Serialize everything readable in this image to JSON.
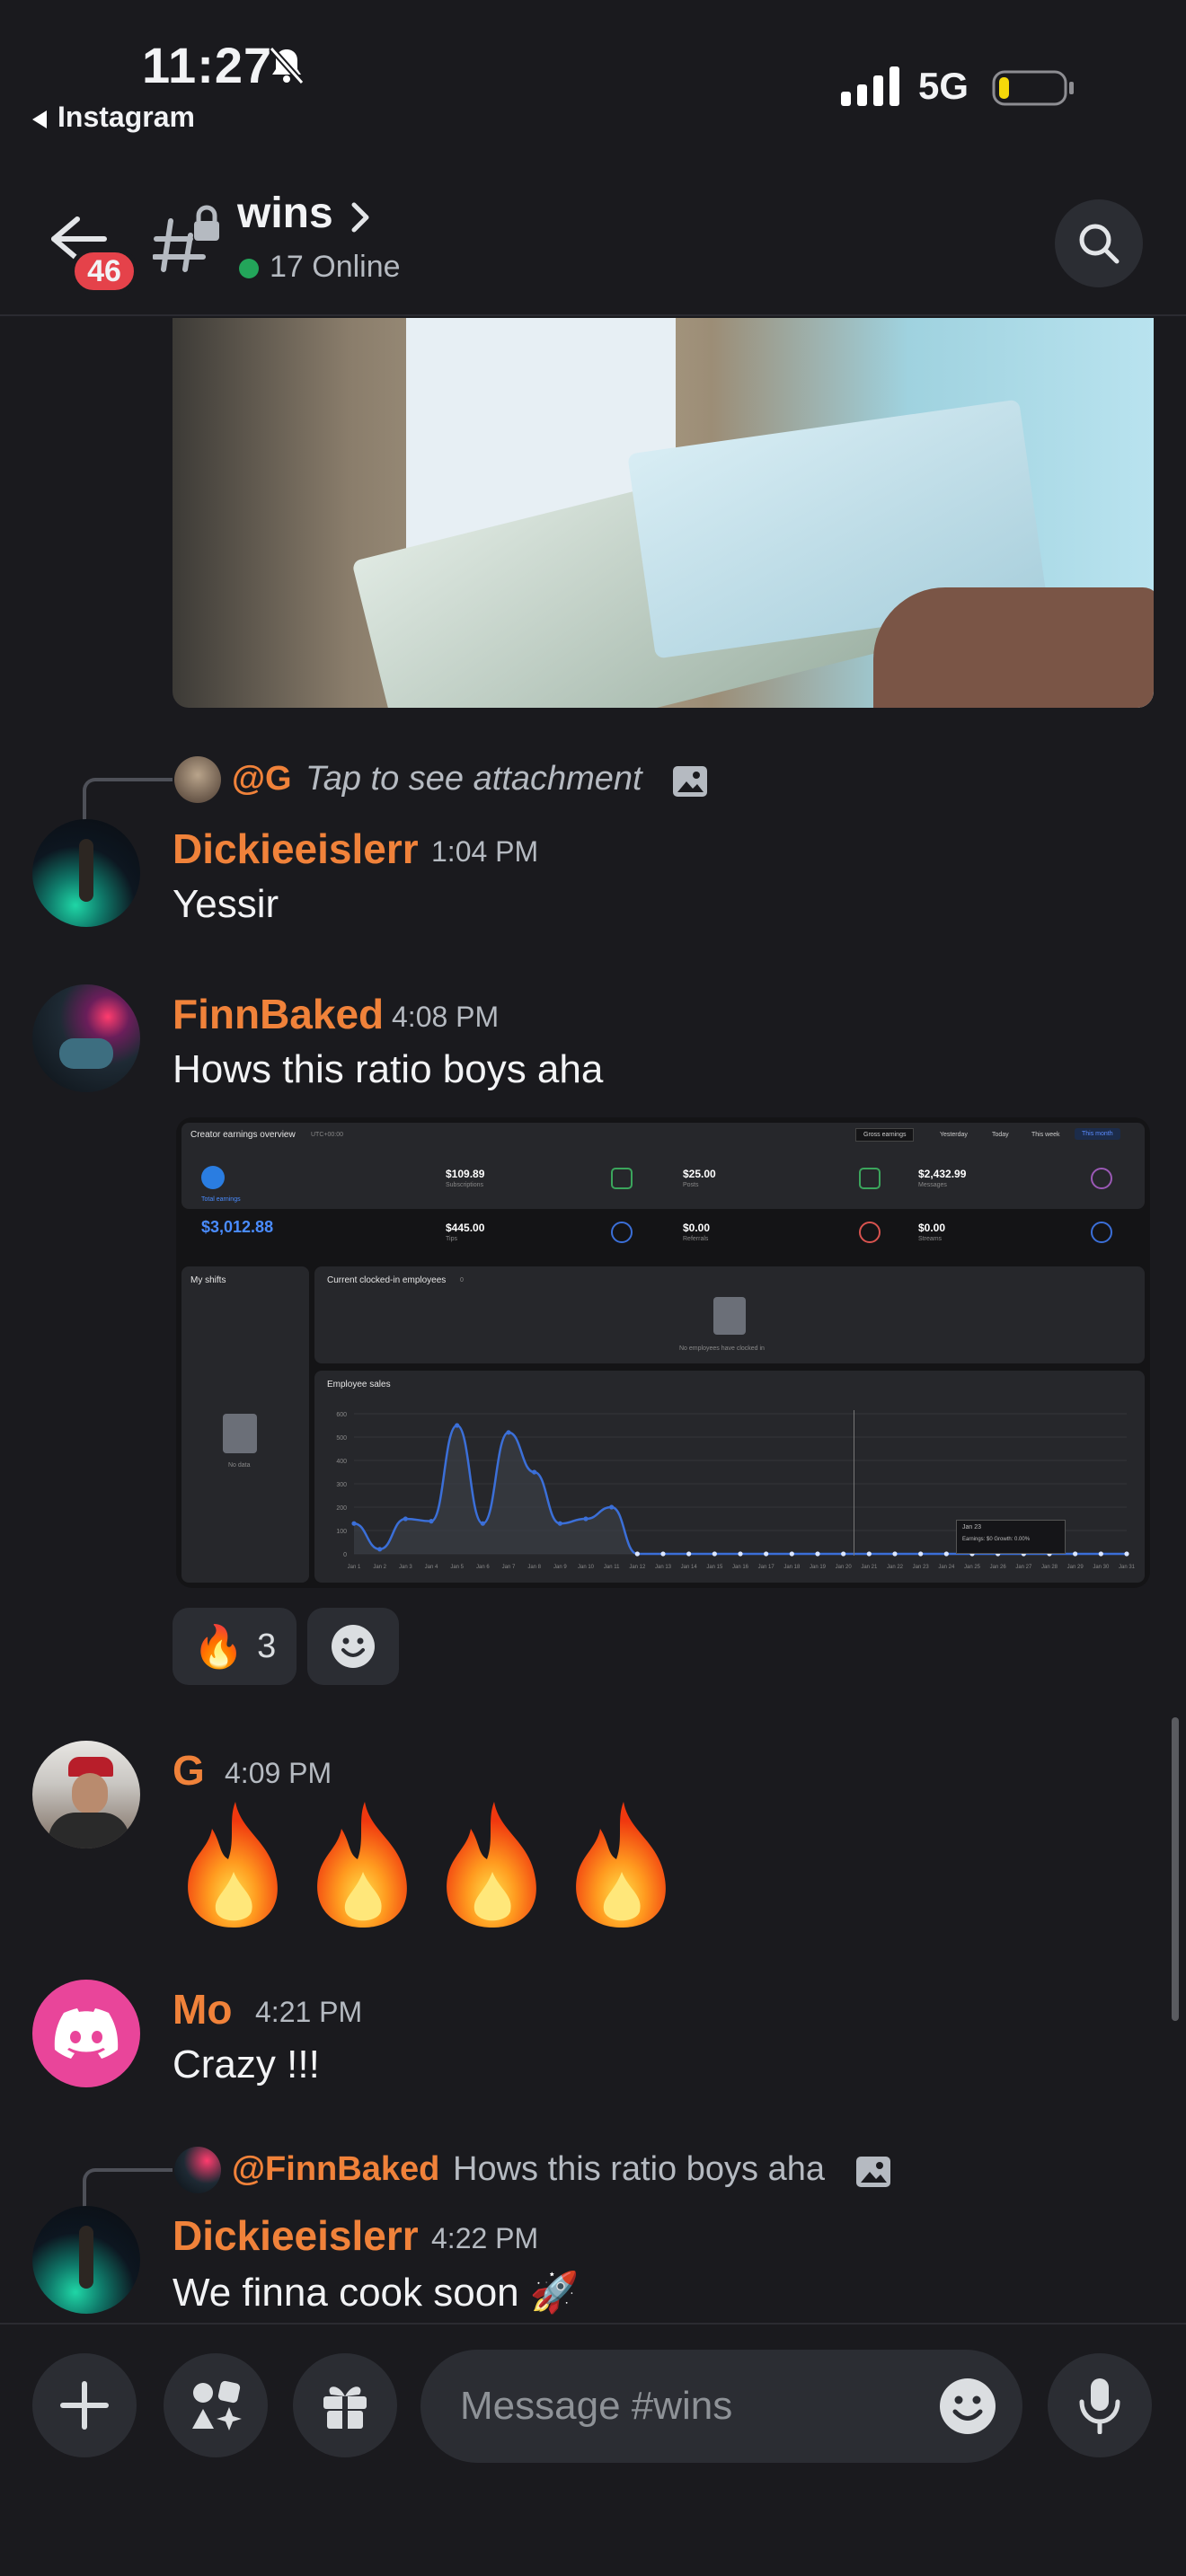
{
  "status_bar": {
    "time": "11:27",
    "back_app": "Instagram",
    "network": "5G"
  },
  "header": {
    "badge_count": "46",
    "channel_name": "wins",
    "online": "17 Online"
  },
  "messages": [
    {
      "reply": {
        "name": "@G",
        "text": "Tap to see attachment"
      },
      "author": "Dickieeislerr",
      "time": "1:04 PM",
      "text": "Yessir"
    },
    {
      "author": "FinnBaked",
      "time": "4:08 PM",
      "text": "Hows this ratio boys aha"
    },
    {
      "author": "G",
      "time": "4:09 PM",
      "text": "🔥🔥🔥🔥"
    },
    {
      "author": "Mo",
      "time": "4:21 PM",
      "text": "Crazy !!!"
    },
    {
      "reply": {
        "name": "@FinnBaked",
        "text": "Hows this ratio boys aha"
      },
      "author": "Dickieeislerr",
      "time": "4:22 PM",
      "text": "We finna cook soon 🚀"
    }
  ],
  "reaction": {
    "emoji": "🔥",
    "count": "3"
  },
  "dashboard": {
    "title": "Creator earnings overview",
    "tz": "UTC+00:00",
    "filter": "Gross earnings",
    "tabs": [
      "Yesterday",
      "Today",
      "This week",
      "This month"
    ],
    "total_label": "Total earnings",
    "total": "$3,012.88",
    "stats": [
      {
        "value": "$109.89",
        "label": "Subscriptions",
        "color": "#3ba55c"
      },
      {
        "value": "$25.00",
        "label": "Posts",
        "color": "#3ba55c"
      },
      {
        "value": "$2,432.99",
        "label": "Messages",
        "color": "#9b59b6"
      },
      {
        "value": "$445.00",
        "label": "Tips",
        "color": "#3b6fd8"
      },
      {
        "value": "$0.00",
        "label": "Referrals",
        "color": "#d9534f"
      },
      {
        "value": "$0.00",
        "label": "Streams",
        "color": "#3b6fd8"
      }
    ],
    "my_shifts": "My shifts",
    "no_data": "No data",
    "clocked_title": "Current clocked-in employees",
    "clocked_count": "0",
    "clocked_empty": "No employees have clocked in",
    "sales_title": "Employee sales",
    "tooltip_date": "Jan 23",
    "tooltip_text": "Earnings: $0 Growth: 0.00%"
  },
  "chart_data": {
    "type": "line",
    "title": "Employee sales",
    "x": [
      "Jan 1",
      "Jan 2",
      "Jan 3",
      "Jan 4",
      "Jan 5",
      "Jan 6",
      "Jan 7",
      "Jan 8",
      "Jan 9",
      "Jan 10",
      "Jan 11",
      "Jan 12",
      "Jan 13",
      "Jan 14",
      "Jan 15",
      "Jan 16",
      "Jan 17",
      "Jan 18",
      "Jan 19",
      "Jan 20",
      "Jan 21",
      "Jan 22",
      "Jan 23",
      "Jan 24",
      "Jan 25",
      "Jan 26",
      "Jan 27",
      "Jan 28",
      "Jan 29",
      "Jan 30",
      "Jan 31"
    ],
    "values": [
      130,
      20,
      150,
      140,
      550,
      130,
      520,
      350,
      130,
      150,
      200,
      0,
      0,
      0,
      0,
      0,
      0,
      0,
      0,
      0,
      0,
      0,
      0,
      0,
      0,
      0,
      0,
      0,
      0,
      0,
      0
    ],
    "yticks": [
      0,
      100,
      200,
      300,
      400,
      500,
      600
    ],
    "ylim": [
      0,
      600
    ],
    "color": "#3b6fd8"
  },
  "composer": {
    "placeholder": "Message #wins"
  }
}
